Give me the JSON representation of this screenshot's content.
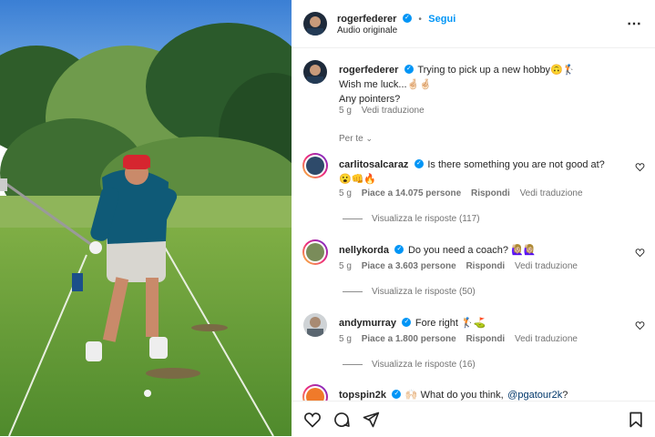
{
  "post": {
    "author": "rogerfederer",
    "follow_label": "Segui",
    "audio_label": "Audio originale",
    "caption_line1": "Trying to pick up a new hobby🙃🏌️",
    "caption_line2": "Wish me luck...🤞🏻🤞🏻",
    "caption_line3": "Any pointers?",
    "age": "5 g",
    "translate": "Vedi traduzione",
    "sort_label": "Per te"
  },
  "comments": [
    {
      "user": "carlitosalcaraz",
      "text_line1": "Is there something you are not good at?",
      "text_line2": "😮👊🔥",
      "age": "5 g",
      "likes": "Piace a 14.075 persone",
      "reply": "Rispondi",
      "translate": "Vedi traduzione",
      "view_replies": "Visualizza le risposte (117)"
    },
    {
      "user": "nellykorda",
      "text_line1": "Do you need a coach? 🙋🏼‍♀️🙋🏼‍♀️",
      "age": "5 g",
      "likes": "Piace a 3.603 persone",
      "reply": "Rispondi",
      "translate": "Vedi traduzione",
      "view_replies": "Visualizza le risposte (50)"
    },
    {
      "user": "andymurray",
      "text_line1": "Fore right 🏌️⛳",
      "age": "5 g",
      "likes": "Piace a 1.800 persone",
      "reply": "Rispondi",
      "translate": "Vedi traduzione",
      "view_replies": "Visualizza le risposte (16)"
    },
    {
      "user": "topspin2k",
      "text_line1": "🙌🏻 What do you think,",
      "mention": "@pgatour2k",
      "text_end": "?"
    }
  ],
  "colors": {
    "accent": "#0095f6",
    "text": "#262626",
    "secondary": "#737373"
  }
}
